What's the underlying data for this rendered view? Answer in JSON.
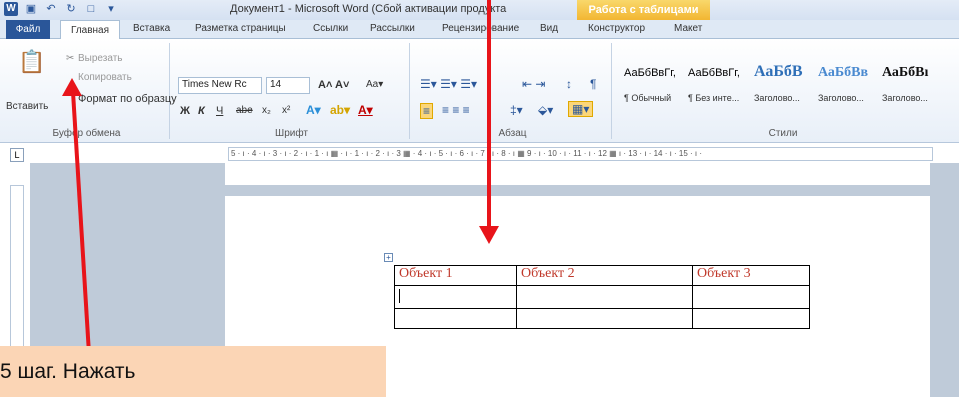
{
  "window": {
    "title": "Документ1 - Microsoft Word (Сбой активации продукта",
    "context_title": "Работа с таблицами"
  },
  "tabs": {
    "file": "Файл",
    "items": [
      "Главная",
      "Вставка",
      "Разметка страницы",
      "Ссылки",
      "Рассылки",
      "Рецензирование",
      "Вид",
      "Конструктор",
      "Макет"
    ]
  },
  "ribbon": {
    "clipboard": {
      "paste": "Вставить",
      "cut": "Вырезать",
      "copy": "Копировать",
      "format_painter": "Формат по образцу",
      "label": "Буфер обмена"
    },
    "font": {
      "family": "Times New Rc",
      "size": "14",
      "label": "Шрифт",
      "bold": "Ж",
      "italic": "К",
      "underline": "Ч",
      "strike": "abe",
      "subscript": "x₂",
      "superscript": "x²"
    },
    "paragraph": {
      "label": "Абзац"
    },
    "styles": {
      "label": "Стили",
      "items": [
        {
          "sample": "АаБбВвГг,",
          "name": "¶ Обычный"
        },
        {
          "sample": "АаБбВвГг,",
          "name": "¶ Без инте..."
        },
        {
          "sample": "АаБбВ",
          "name": "Заголово..."
        },
        {
          "sample": "АаБбВв",
          "name": "Заголово..."
        },
        {
          "sample": "АаБбВı",
          "name": "Заголово..."
        }
      ]
    }
  },
  "ruler": {
    "text": "5 · ı · 4 · ı · 3 · ı · 2 · ı · 1 · ı ▦ · ı · 1 · ı · 2 · ı · 3 ▦ · 4 · ı · 5 · ı · 6 · ı · 7 · ı · 8 · ı ▦ 9 · ı · 10 · ı · 11 · ı · 12 ▦ ı · 13 · ı · 14 · ı · 15 · ı ·"
  },
  "table": {
    "rows": [
      [
        "Объект 1",
        "Объект 2",
        "Объект 3"
      ],
      [
        "",
        "",
        ""
      ],
      [
        "",
        "",
        ""
      ]
    ]
  },
  "callout": {
    "text": "5 шаг. Нажать"
  },
  "colors": {
    "accent": "#2b579a",
    "annotation": "#e8141a",
    "table_text": "#c0392b"
  },
  "icons": [
    "word-icon",
    "save-icon",
    "undo-icon",
    "redo-icon",
    "paste-icon",
    "scissors-icon",
    "table-move-icon"
  ]
}
